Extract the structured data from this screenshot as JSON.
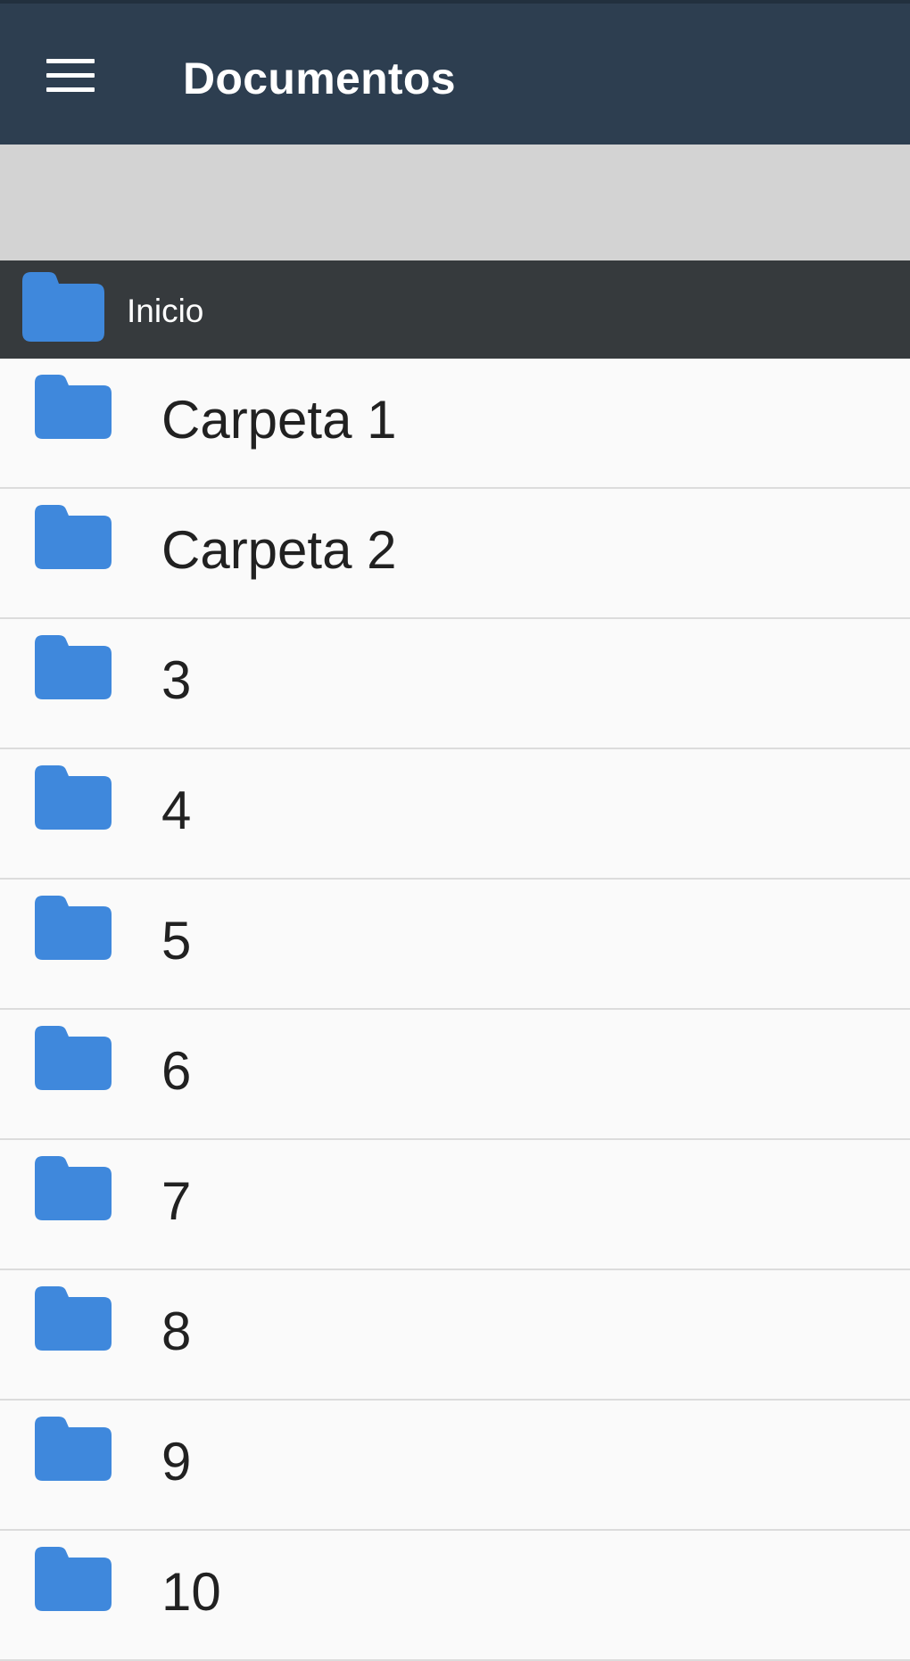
{
  "colors": {
    "app_bar": "#2d3e50",
    "gray_band": "#d3d3d3",
    "breadcrumb_bar": "#363a3d",
    "folder_icon": "#3f88dc",
    "list_background": "#fafafa",
    "divider": "#dcdcdc",
    "row_text": "#212121"
  },
  "app_bar": {
    "menu_icon": "hamburger-menu-icon",
    "title": "Documentos"
  },
  "breadcrumb": {
    "icon": "folder-icon",
    "label": "Inicio"
  },
  "folders": [
    {
      "icon": "folder-icon",
      "label": "Carpeta 1"
    },
    {
      "icon": "folder-icon",
      "label": "Carpeta 2"
    },
    {
      "icon": "folder-icon",
      "label": "3"
    },
    {
      "icon": "folder-icon",
      "label": "4"
    },
    {
      "icon": "folder-icon",
      "label": "5"
    },
    {
      "icon": "folder-icon",
      "label": "6"
    },
    {
      "icon": "folder-icon",
      "label": "7"
    },
    {
      "icon": "folder-icon",
      "label": "8"
    },
    {
      "icon": "folder-icon",
      "label": "9"
    },
    {
      "icon": "folder-icon",
      "label": "10"
    }
  ]
}
